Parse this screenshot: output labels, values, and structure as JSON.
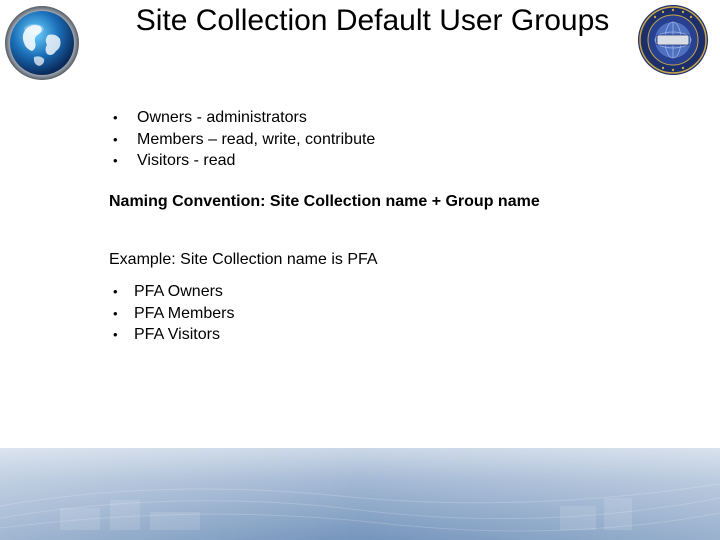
{
  "slide": {
    "title": "Site Collection Default User Groups",
    "default_groups": [
      "Owners - administrators",
      "Members – read, write, contribute",
      "Visitors  - read"
    ],
    "naming_convention": "Naming Convention: Site Collection name + Group name",
    "example_label": "Example: Site Collection name is PFA",
    "example_groups": [
      "PFA Owners",
      "PFA Members",
      "PFA Visitors"
    ]
  },
  "icons": {
    "top_left": "globe-icon",
    "top_right": "seal-icon"
  },
  "colors": {
    "footer_blue": "#6d8fb8",
    "footer_light": "#c9d6e6",
    "seal_navy": "#1c2f6b"
  }
}
